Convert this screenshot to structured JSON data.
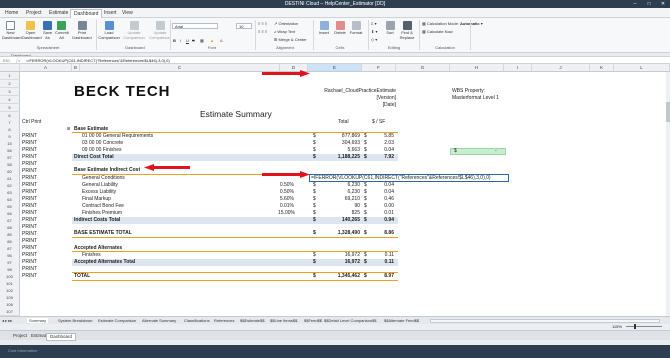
{
  "window": {
    "title": "DESTINI Cloud – HelpCenter_Estimator [DD]"
  },
  "menu": [
    "Home",
    "Project",
    "Estimate",
    "Dashboard",
    "Insert",
    "View"
  ],
  "ribbon": {
    "spreadsheet": {
      "new": "New Dashboard",
      "open": "Open Dashboard",
      "save": "Save As",
      "commit": "Commit All",
      "print": "Print Dashboard",
      "group": "Spreadsheet"
    },
    "dashboard": {
      "load": "Load Comparison",
      "update": "Update Comparison",
      "group": "Dashboard"
    },
    "font": {
      "name": "Arial",
      "size": "10",
      "group": "Font"
    },
    "alignment": {
      "orientation": "Orientation",
      "wrap": "Wrap Text",
      "merge": "Merge & Center",
      "group": "Alignment"
    },
    "cells": {
      "insert": "Insert",
      "delete": "Delete",
      "format": "Format",
      "group": "Cells"
    },
    "editing": {
      "sort": "Sort",
      "find": "Find & Replace",
      "group": "Editing"
    },
    "calculation": {
      "mode_label": "Calculation Mode:",
      "mode_value": "Automatic",
      "calc_now": "Calculate Now",
      "group": "Calculation"
    }
  },
  "tab_label": "Dashboard",
  "formula_bar": {
    "cell_ref": "E61",
    "formula": "=IFERROR(VLOOKUP(C61,INDIRECT(\"References\"&References!$L$46),3,0),0)"
  },
  "columns": [
    "A",
    "B",
    "C",
    "D",
    "E",
    "F",
    "G",
    "H",
    "I",
    "J",
    "K",
    "L"
  ],
  "rows": {
    "r1": "1",
    "r2": "2",
    "r3": "3",
    "r4": "4",
    "r5": "5",
    "r6": "6",
    "r7": "7",
    "r8": "8",
    "r9": "9",
    "r15": "15",
    "r56": "56",
    "r57": "57",
    "r58": "58",
    "r60": "60",
    "r61": "61",
    "r62": "62",
    "r63": "63",
    "r64": "64",
    "r65": "65",
    "r66": "66",
    "r67": "67",
    "r68": "68",
    "r85": "85",
    "r86": "86",
    "r87": "87",
    "r96": "96",
    "r97": "97",
    "r98": "98",
    "r100": "100",
    "r101": "101",
    "r102": "102",
    "r105": "105",
    "r106": "106",
    "r107": "107"
  },
  "logo": "BECK TECH",
  "header_right": {
    "project": "Rachael_CloudPracticeEstimate",
    "version": "[Version]",
    "date": "[Date]"
  },
  "wbs": {
    "label": "WBS Property:",
    "value": "Masterformat Level 1"
  },
  "sheet_title": "Estimate Summary",
  "ctrl_print": "Ctrl Print",
  "col_headers": {
    "total": "Total",
    "per_sf": "$ / SF"
  },
  "base_estimate": {
    "title": "Base Estimate",
    "items": [
      {
        "name": "01 00 00 General Requirements",
        "total": "877,869",
        "psf": "5.85"
      },
      {
        "name": "03 00 00 Concrete",
        "total": "304,693",
        "psf": "2.03"
      },
      {
        "name": "09 00 00 Finishes",
        "total": "5,663",
        "psf": "0.04"
      }
    ],
    "total_label": "Direct Cost Total",
    "total": "1,188,225",
    "total_psf": "7.92"
  },
  "green_cell": {
    "currency": "$",
    "value": "-"
  },
  "indirect": {
    "title": "Base Estimate Indirect Cost",
    "first_item": "General Conditions",
    "first_formula": "=IFERROR(VLOOKUP(C61,INDIRECT(\"References\"&References!$L$46),3,0),0)",
    "items": [
      {
        "name": "General Liability",
        "pct": "0.50%",
        "total": "6,230",
        "psf": "0.04"
      },
      {
        "name": "Excess Liability",
        "pct": "0.50%",
        "total": "6,230",
        "psf": "0.04"
      },
      {
        "name": "Final Markup",
        "pct": "5.60%",
        "total": "69,210",
        "psf": "0.46"
      },
      {
        "name": "Contract Bond Fee",
        "pct": "0.01%",
        "total": "90",
        "psf": "0.00"
      },
      {
        "name": "Finishes Premium",
        "pct": "15.00%",
        "total": "825",
        "psf": "0.01"
      }
    ],
    "total_label": "Indirect Costs Total",
    "total": "140,265",
    "total_psf": "0.94"
  },
  "base_total": {
    "label": "BASE ESTIMATE TOTAL",
    "total": "1,328,490",
    "psf": "8.86"
  },
  "alternates": {
    "title": "Accepted Alternates",
    "item": {
      "name": "Finishes",
      "total": "16,972",
      "psf": "0.11"
    },
    "total_label": "Accepted Alternates Total",
    "total": "16,972",
    "total_psf": "0.11"
  },
  "grand_total": {
    "label": "TOTAL",
    "total": "1,345,462",
    "psf": "8.97"
  },
  "print_label": "PRINT",
  "currency": "$",
  "sheet_tabs": [
    "Summary",
    "System Breakdown",
    "Estimate Comparison",
    "Alternate Summary",
    "Classifications",
    "References",
    "$$Estimate$$",
    "$$Line Items$$",
    "$$Feed$$",
    "$$Detail Level Comparison$$",
    "$$Alternate Feed$$"
  ],
  "bottom_tabs": [
    "Project",
    "Estimate",
    "Dashboard"
  ],
  "zoom": "115%",
  "status_text": "Cost Information",
  "colors": {
    "accent": "#2d3e50",
    "arrow": "#e0141e",
    "orange": "#f0a020",
    "green": "#c6efce"
  }
}
